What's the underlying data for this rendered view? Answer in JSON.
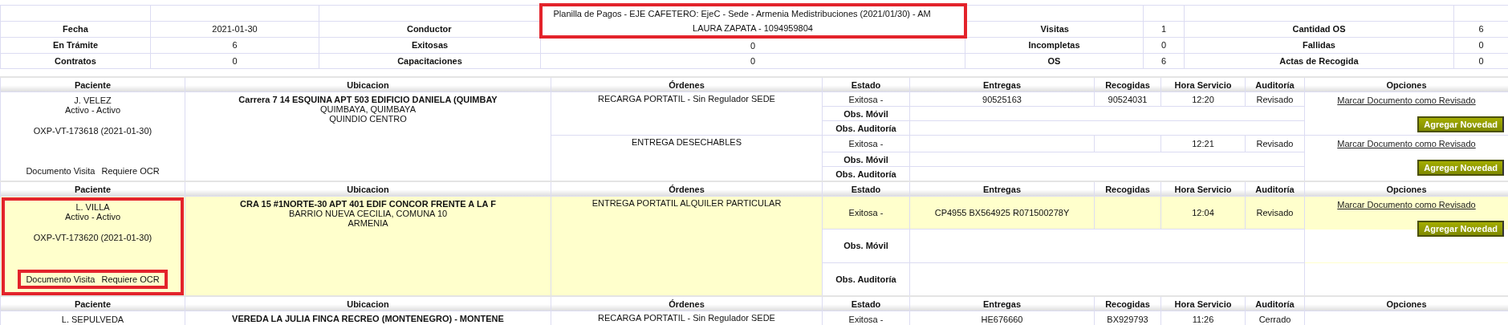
{
  "summary": {
    "title": "Planilla de Pagos - EJE CAFETERO: EjeC - Sede - Armenia Medistribuciones (2021/01/30) - AM",
    "highlighted": true,
    "rows": [
      [
        {
          "label": "Fecha",
          "value": "2021-01-30"
        },
        {
          "label": "Conductor",
          "value": "LAURA ZAPATA - 1094959804"
        },
        {
          "label": "Visitas",
          "value": "1"
        },
        {
          "label": "Cantidad OS",
          "value": "6"
        }
      ],
      [
        {
          "label": "En Trámite",
          "value": "6"
        },
        {
          "label": "Exitosas",
          "value": "0"
        },
        {
          "label": "Incompletas",
          "value": "0"
        },
        {
          "label": "Fallidas",
          "value": "0"
        }
      ],
      [
        {
          "label": "Contratos",
          "value": "0"
        },
        {
          "label": "Capacitaciones",
          "value": "0"
        },
        {
          "label": "OS",
          "value": "6"
        },
        {
          "label": "Actas de Recogida",
          "value": "0"
        }
      ]
    ]
  },
  "visits": [
    {
      "columns": [
        "Paciente",
        "Ubicacion",
        "Órdenes",
        "Estado",
        "Entregas",
        "Recogidas",
        "Hora Servicio",
        "Auditoría",
        "Opciones"
      ],
      "patient": "J. VELEZ",
      "status": "Activo - Activo",
      "code": "OXP-VT-173618 (2021-01-30)",
      "documents": [
        "Documento Visita",
        "Requiere OCR"
      ],
      "address": [
        "Carrera 7 14 ESQUINA APT 503 EDIFICIO DANIELA (QUIMBAY",
        "QUIMBAYA, QUIMBAYA",
        "QUINDIO CENTRO"
      ],
      "highlighted": false,
      "marked": false,
      "orders": [
        {
          "name": "RECARGA PORTATIL - Sin Regulador SEDE",
          "estado": "Exitosa -",
          "entregas": "90525163",
          "recogidas": "90524031",
          "hora": "12:20",
          "auditoria": "Revisado",
          "obs_labels": [
            "Obs. Móvil",
            "Obs. Auditoría"
          ],
          "link": "Marcar Documento como Revisado",
          "button": "Agregar Novedad"
        },
        {
          "name": "ENTREGA DESECHABLES",
          "estado": "Exitosa -",
          "hora": "12:21",
          "auditoria": "Revisado",
          "obs_labels": [
            "Obs. Móvil",
            "Obs. Auditoría"
          ],
          "link": "Marcar Documento como Revisado",
          "button": "Agregar Novedad"
        }
      ]
    },
    {
      "columns": [
        "Paciente",
        "Ubicacion",
        "Órdenes",
        "Estado",
        "Entregas",
        "Recogidas",
        "Hora Servicio",
        "Auditoría",
        "Opciones"
      ],
      "patient": "L. VILLA",
      "status": "Activo - Activo",
      "code": "OXP-VT-173620 (2021-01-30)",
      "documents": [
        "Documento Visita",
        "Requiere OCR"
      ],
      "address": [
        "CRA 15 #1NORTE-30 APT 401 EDIF CONCOR FRENTE A LA F",
        "BARRIO NUEVA CECILIA, COMUNA 10",
        "ARMENIA"
      ],
      "highlighted": true,
      "marked": true,
      "orders": [
        {
          "name": "ENTREGA PORTATIL ALQUILER PARTICULAR",
          "estado": "Exitosa -",
          "entregas": "CP4955 BX564925 R071500278Y",
          "hora": "12:04",
          "auditoria": "Revisado",
          "obs_labels": [
            "Obs. Móvil",
            "Obs. Auditoría"
          ],
          "link": "Marcar Documento como Revisado",
          "button": "Agregar Novedad"
        }
      ]
    },
    {
      "columns": [
        "Paciente",
        "Ubicacion",
        "Órdenes",
        "Estado",
        "Entregas",
        "Recogidas",
        "Hora Servicio",
        "Auditoría",
        "Opciones"
      ],
      "patient": "L. SEPULVEDA",
      "address": [
        "VEREDA LA JULIA FINCA RECREO (MONTENEGRO) - MONTENE"
      ],
      "highlighted": false,
      "marked": false,
      "orders": [
        {
          "name": "RECARGA PORTATIL - Sin Regulador SEDE",
          "estado": "Exitosa -",
          "entregas": "HE676660",
          "recogidas": "BX929793",
          "hora": "11:26",
          "auditoria": "Cerrado"
        }
      ]
    }
  ]
}
